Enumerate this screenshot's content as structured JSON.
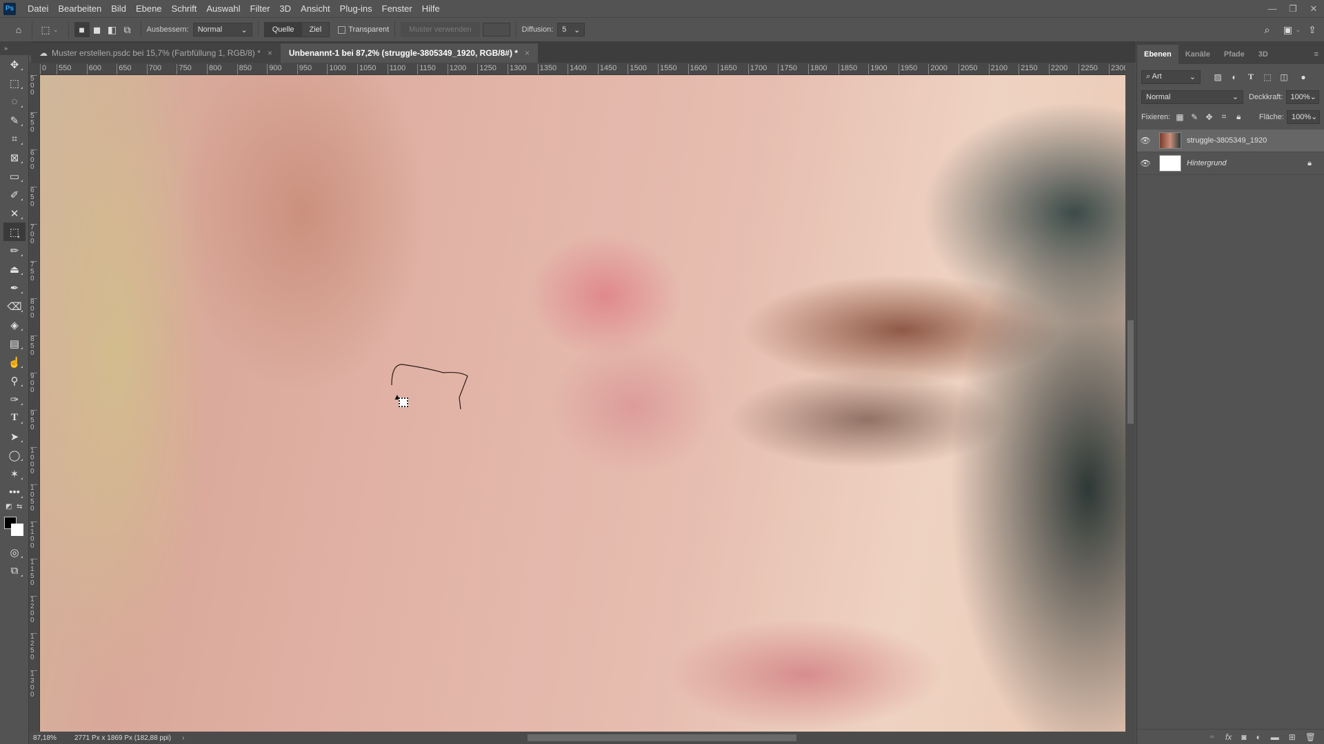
{
  "app": {
    "logo": "Ps"
  },
  "menu": [
    "Datei",
    "Bearbeiten",
    "Bild",
    "Ebene",
    "Schrift",
    "Auswahl",
    "Filter",
    "3D",
    "Ansicht",
    "Plug-ins",
    "Fenster",
    "Hilfe"
  ],
  "window_controls": {
    "minimize": "—",
    "restore": "❐",
    "close": "✕"
  },
  "options": {
    "ausbessern_label": "Ausbessern:",
    "ausbessern_value": "Normal",
    "source_label": "Quelle",
    "target_label": "Ziel",
    "transparent_label": "Transparent",
    "transparent_checked": false,
    "use_pattern_label": "Muster verwenden",
    "diffusion_label": "Diffusion:",
    "diffusion_value": "5"
  },
  "doc_tabs": [
    {
      "title": "Muster erstellen.psdc bei 15,7% (Farbfüllung 1, RGB/8) *",
      "cloud": true,
      "active": false
    },
    {
      "title": "Unbenannt-1 bei 87,2% (struggle-3805349_1920, RGB/8#) *",
      "cloud": false,
      "active": true
    }
  ],
  "ruler_h_labels": [
    "0",
    "550",
    "600",
    "650",
    "700",
    "750",
    "800",
    "850",
    "900",
    "950",
    "1000",
    "1050",
    "1100",
    "1150",
    "1200",
    "1250",
    "1300",
    "1350",
    "1400",
    "1450",
    "1500",
    "1550",
    "1600",
    "1650",
    "1700",
    "1750",
    "1800",
    "1850",
    "1900",
    "1950",
    "2000",
    "2050",
    "2100",
    "2150",
    "2200",
    "2250",
    "2300"
  ],
  "ruler_v_labels": [
    "500",
    "550",
    "600",
    "650",
    "700",
    "750",
    "800",
    "850",
    "900",
    "950",
    "1000",
    "1050",
    "1100",
    "1150",
    "1200",
    "1250",
    "1300"
  ],
  "status": {
    "zoom": "87,18%",
    "doc_info": "2771 Px x 1869 Px (182,88 ppi)"
  },
  "layers_panel": {
    "tabs": [
      "Ebenen",
      "Kanäle",
      "Pfade",
      "3D"
    ],
    "active_tab": "Ebenen",
    "filter_label": "Art",
    "blend_mode": "Normal",
    "opacity_label": "Deckkraft:",
    "opacity_value": "100%",
    "lock_label": "Fixieren:",
    "fill_label": "Fläche:",
    "fill_value": "100%",
    "layers": [
      {
        "name": "struggle-3805349_1920",
        "visible": true,
        "selected": true,
        "locked": false
      },
      {
        "name": "Hintergrund",
        "visible": true,
        "selected": false,
        "locked": true
      }
    ]
  },
  "tools": [
    "move",
    "marquee",
    "lasso",
    "quick-selection",
    "crop",
    "frame",
    "ruler",
    "eyedropper",
    "content-aware-move",
    "patch",
    "brush",
    "clone-stamp",
    "history-brush",
    "eraser",
    "paint-bucket",
    "gradient",
    "smudge",
    "dodge",
    "pen",
    "type",
    "path-selection",
    "ellipse",
    "custom-shape",
    "more-tools"
  ],
  "active_tool": "patch"
}
